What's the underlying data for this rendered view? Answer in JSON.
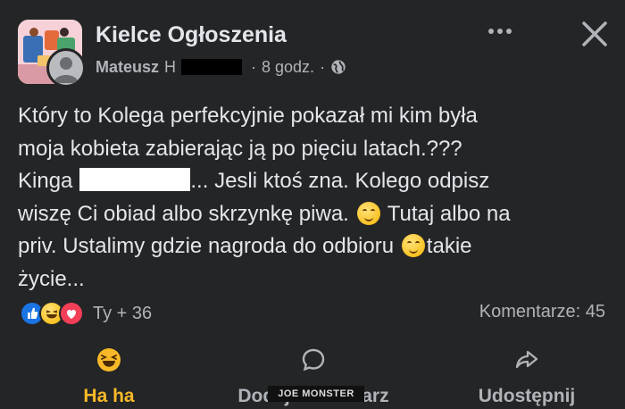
{
  "header": {
    "group_name": "Kielce Ogłoszenia",
    "author": "Mateusz",
    "author_redacted_suffix": "H",
    "time": "8 godz.",
    "separator": "·",
    "visibility_icon": "globe-icon",
    "more_icon": "more-horizontal-icon",
    "close_icon": "close-icon"
  },
  "post": {
    "lines": {
      "l1": "Który to Kolega perfekcyjnie pokazał mi kim była",
      "l2": "moja kobieta zabierając ją po pięciu latach.???",
      "l3_start": "Kinga",
      "l3_end": "... Jesli ktoś zna. Kolego odpisz",
      "l4_start": "wiszę Ci obiad albo skrzynkę piwa.",
      "l4_end": "Tutaj albo na",
      "l5_start": "priv. Ustalimy gdzie nagroda do odbioru",
      "l5_end": "takie",
      "l6": "życie..."
    }
  },
  "reactions": {
    "icons": [
      "like-icon",
      "haha-icon",
      "love-icon"
    ],
    "count_text": "Ty + 36",
    "comments_text": "Komentarze: 45"
  },
  "actions": {
    "haha_label": "Ha ha",
    "comment_label": "Dodaj komentarz",
    "share_label": "Udostępnij"
  },
  "watermark": {
    "text": "JOE MONSTER"
  },
  "colors": {
    "background": "#242526",
    "text": "#e4e6eb",
    "secondary": "#b0b3b8",
    "haha_accent": "#f7b928",
    "like": "#1b74e4",
    "love": "#f33e58"
  }
}
